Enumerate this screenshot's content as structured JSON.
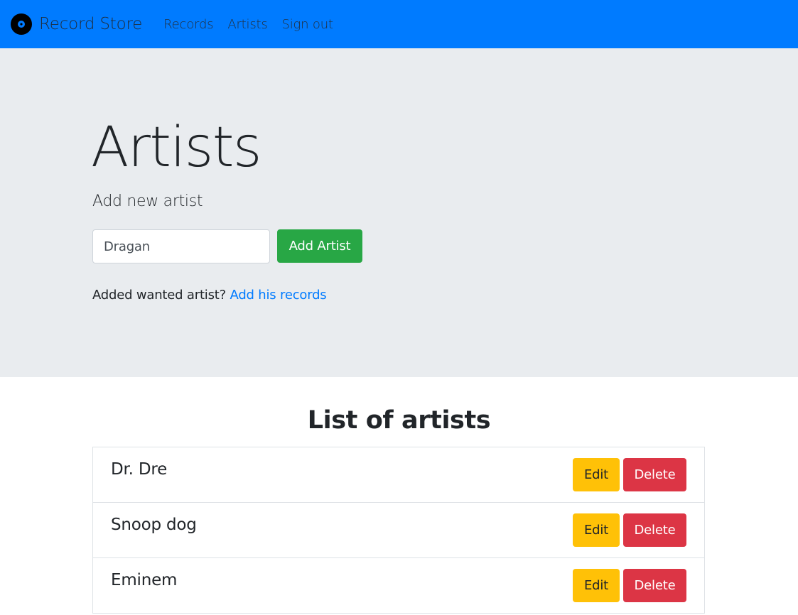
{
  "navbar": {
    "brand": "Record Store",
    "links": [
      "Records",
      "Artists",
      "Sign out"
    ]
  },
  "jumbotron": {
    "title": "Artists",
    "lead": "Add new artist",
    "input_value": "Dragan",
    "add_button": "Add Artist",
    "hint_text": "Added wanted artist?",
    "hint_link": "Add his records"
  },
  "list": {
    "title": "List of artists",
    "edit_label": "Edit",
    "delete_label": "Delete",
    "artists": [
      "Dr. Dre",
      "Snoop dog",
      "Eminem"
    ]
  },
  "colors": {
    "primary": "#007bff",
    "success": "#28a745",
    "warning": "#ffc107",
    "danger": "#dc3545",
    "jumbotron_bg": "#e9ecef"
  }
}
